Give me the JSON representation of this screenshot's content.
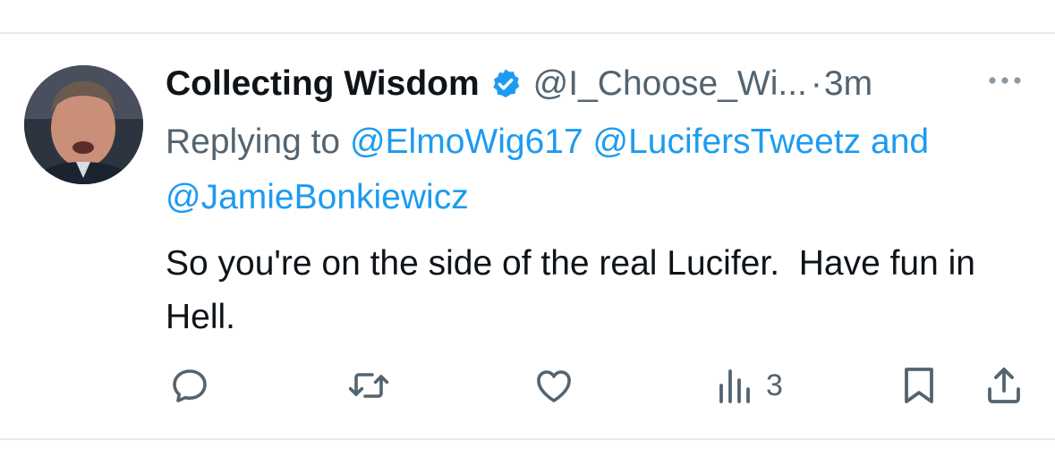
{
  "tweet": {
    "display_name": "Collecting Wisdom",
    "handle": "@I_Choose_Wi...",
    "separator": "·",
    "time": "3m",
    "replying_prefix": "Replying to ",
    "mentions": [
      "@ElmoWig617",
      "@LucifersTweetz",
      "@JamieBonkiewicz"
    ],
    "mention_joiner": " and",
    "text": "So you're on the side of the real Lucifer.  Have fun in Hell.",
    "views_count": "3"
  },
  "icons": {
    "verified": "verified-badge-icon",
    "more": "more-horizontal-icon",
    "reply": "reply-icon",
    "retweet": "retweet-icon",
    "like": "heart-icon",
    "views": "views-chart-icon",
    "bookmark": "bookmark-icon",
    "share": "share-icon"
  },
  "colors": {
    "link": "#1d9bf0",
    "secondary_text": "#536471",
    "primary_text": "#0f1419",
    "divider": "#e6e9ec"
  }
}
